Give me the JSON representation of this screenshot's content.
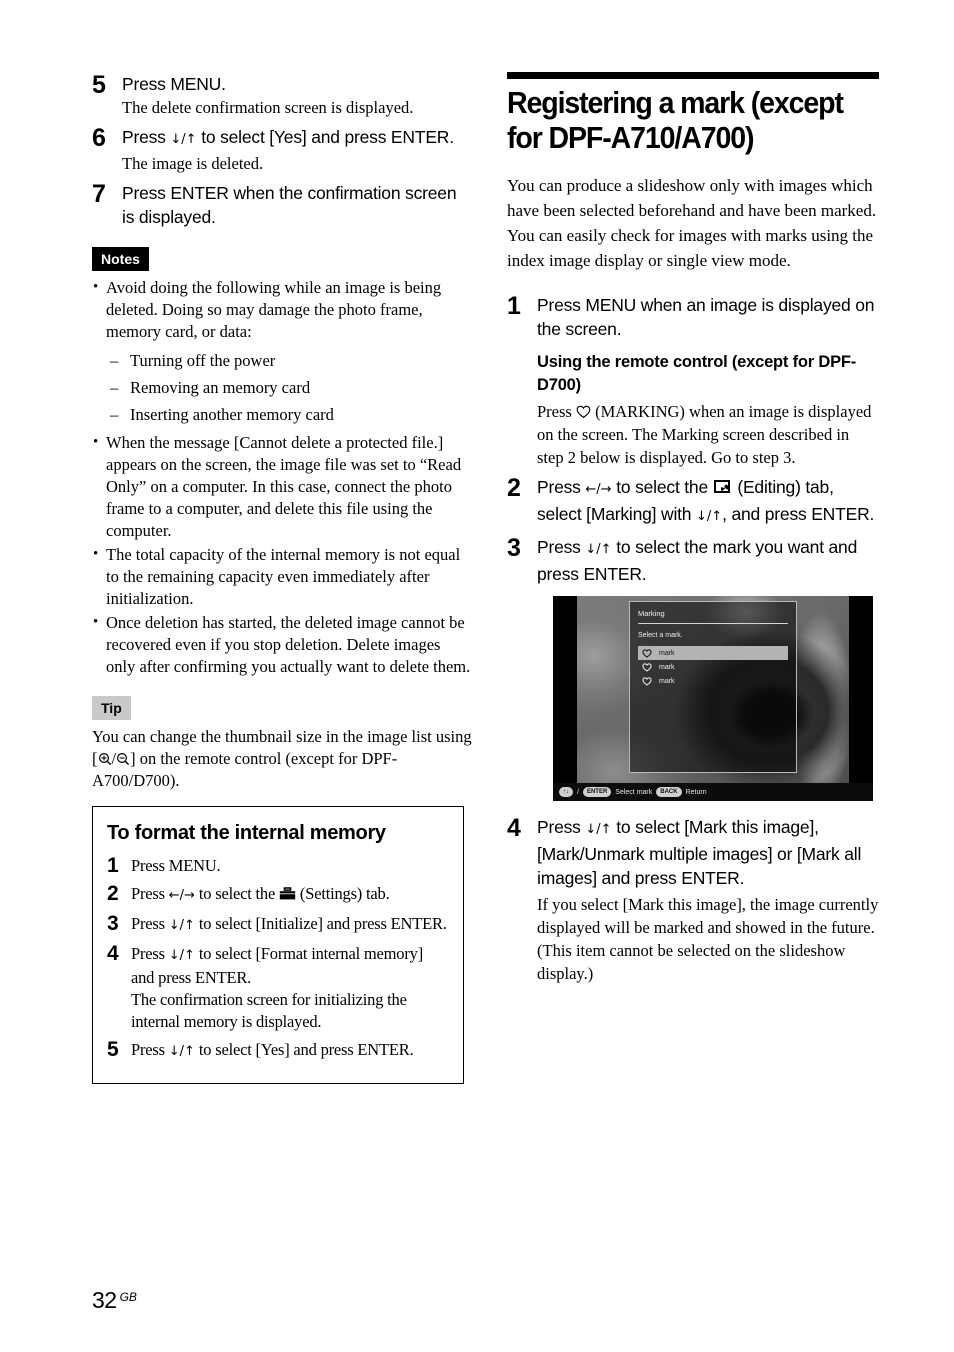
{
  "footer": {
    "page_number": "32",
    "region": "GB"
  },
  "left_column": {
    "steps": [
      {
        "num": "5",
        "title": "Press MENU.",
        "desc": "The delete confirmation screen is displayed."
      },
      {
        "num": "6",
        "title_pre": "Press ",
        "title_arrows": "↓/↑",
        "title_post": " to select [Yes] and press ENTER.",
        "desc": "The image is deleted."
      },
      {
        "num": "7",
        "title": "Press ENTER when the confirmation screen is displayed.",
        "desc": ""
      }
    ],
    "notes_badge": "Notes",
    "notes": [
      "Avoid doing the following while an image is being deleted. Doing so may damage the photo frame, memory card, or data:",
      "When the message [Cannot delete a protected file.] appears on the screen, the image file was set to “Read Only” on a computer. In this case, connect the photo frame to a computer, and delete this file using the computer.",
      "The total capacity of the internal memory is not equal to the remaining capacity even immediately after initialization.",
      "Once deletion has started, the deleted image cannot be recovered even if you stop deletion. Delete images only after confirming you actually want to delete them."
    ],
    "note_sub_items": [
      "Turning off the power",
      "Removing an memory card",
      "Inserting another memory card"
    ],
    "tip_badge": "Tip",
    "tip_text_pre": "You can change the thumbnail size in the image list using [",
    "tip_icon_zoom_in": "zoom-in-icon",
    "tip_icon_sep": "/",
    "tip_icon_zoom_out": "zoom-out-icon",
    "tip_text_post": "] on the remote control (except for DPF-A700/D700)."
  },
  "format_box": {
    "title": "To format the internal memory",
    "steps": [
      {
        "num": "1",
        "text": "Press MENU."
      },
      {
        "num": "2",
        "text_pre": "Press ",
        "arrows": "←/→",
        "text_mid": " to select the ",
        "icon": "settings-toolbox-icon",
        "text_post": " (Settings) tab."
      },
      {
        "num": "3",
        "text_pre": "Press ",
        "arrows": "↓/↑",
        "text_post": " to select [Initialize] and press ENTER."
      },
      {
        "num": "4",
        "text_pre": "Press ",
        "arrows": "↓/↑",
        "text_post": " to select [Format internal memory] and press ENTER.",
        "desc": "The confirmation screen for initializing the internal memory is displayed."
      },
      {
        "num": "5",
        "text_pre": "Press ",
        "arrows": "↓/↑",
        "text_post": " to select [Yes] and press ENTER."
      }
    ]
  },
  "right_column": {
    "section_title": "Registering a mark (except for DPF-A710/A700)",
    "intro": "You can produce a slideshow only with images which have been selected beforehand and have been marked. You can easily check for images with marks using the index image display or single view mode.",
    "steps": [
      {
        "num": "1",
        "title": "Press MENU when an image is displayed on the screen.",
        "sub_head": "Using the remote control (except for DPF-D700)",
        "sub_body_pre": "Press ",
        "sub_body_icon": "heart-marking-icon",
        "sub_body_post": " (MARKING) when an image is displayed on the screen. The Marking screen described in step 2 below is displayed. Go to step 3."
      },
      {
        "num": "2",
        "title_pre": "Press ",
        "arrows": "←/→",
        "title_mid": " to select the ",
        "icon": "editing-pen-icon",
        "title_post2": " (Editing) tab, select [Marking] with ",
        "arrows2": "↓/↑",
        "title_end": ", and press ENTER."
      },
      {
        "num": "3",
        "title_pre": "Press ",
        "arrows": "↓/↑",
        "title_post": " to select the mark you want and press ENTER."
      },
      {
        "num": "4",
        "title_pre": "Press ",
        "arrows": "↓/↑",
        "title_post": " to select [Mark this image], [Mark/Unmark multiple images] or [Mark all images] and press ENTER.",
        "desc": "If you select [Mark this image], the image currently displayed will be marked and showed in the future. (This item cannot be selected on the slideshow display.)"
      }
    ],
    "screenshot": {
      "panel_title": "Marking",
      "panel_subtitle": "Select a mark.",
      "items": [
        {
          "label": "mark",
          "selected": true
        },
        {
          "label": "mark",
          "selected": false
        },
        {
          "label": "mark",
          "selected": false
        }
      ],
      "status_bar": {
        "nav_pill": "↑↓",
        "separator": "/",
        "enter_pill": "ENTER",
        "enter_label": "Select mark",
        "back_pill": "BACK",
        "back_label": "Return"
      }
    }
  }
}
